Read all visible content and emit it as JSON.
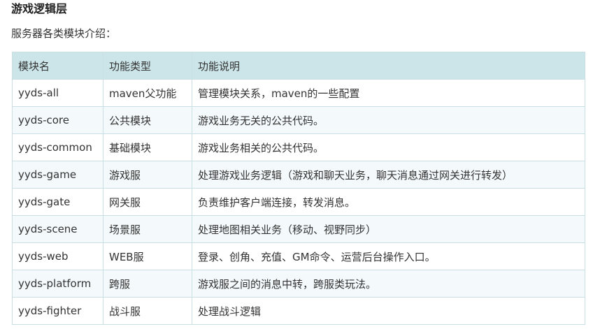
{
  "section": {
    "title": "游戏逻辑层",
    "intro": "服务器各类模块介绍："
  },
  "table": {
    "headers": [
      "模块名",
      "功能类型",
      "功能说明"
    ],
    "rows": [
      [
        "yyds-all",
        "maven父功能",
        "管理模块关系，maven的一些配置"
      ],
      [
        "yyds-core",
        "公共模块",
        "游戏业务无关的公共代码。"
      ],
      [
        "yyds-common",
        "基础模块",
        "游戏业务相关的公共代码。"
      ],
      [
        "yyds-game",
        "游戏服",
        "处理游戏业务逻辑（游戏和聊天业务，聊天消息通过网关进行转发）"
      ],
      [
        "yyds-gate",
        "网关服",
        "负责维护客户端连接，转发消息。"
      ],
      [
        "yyds-scene",
        "场景服",
        "处理地图相关业务（移动、视野同步）"
      ],
      [
        "yyds-web",
        "WEB服",
        "登录、创角、充值、GM命令、运营后台操作入口。"
      ],
      [
        "yyds-platform",
        "跨服",
        "游戏服之间的消息中转，跨服类玩法。"
      ],
      [
        "yyds-fighter",
        "战斗服",
        "处理战斗逻辑"
      ]
    ]
  }
}
